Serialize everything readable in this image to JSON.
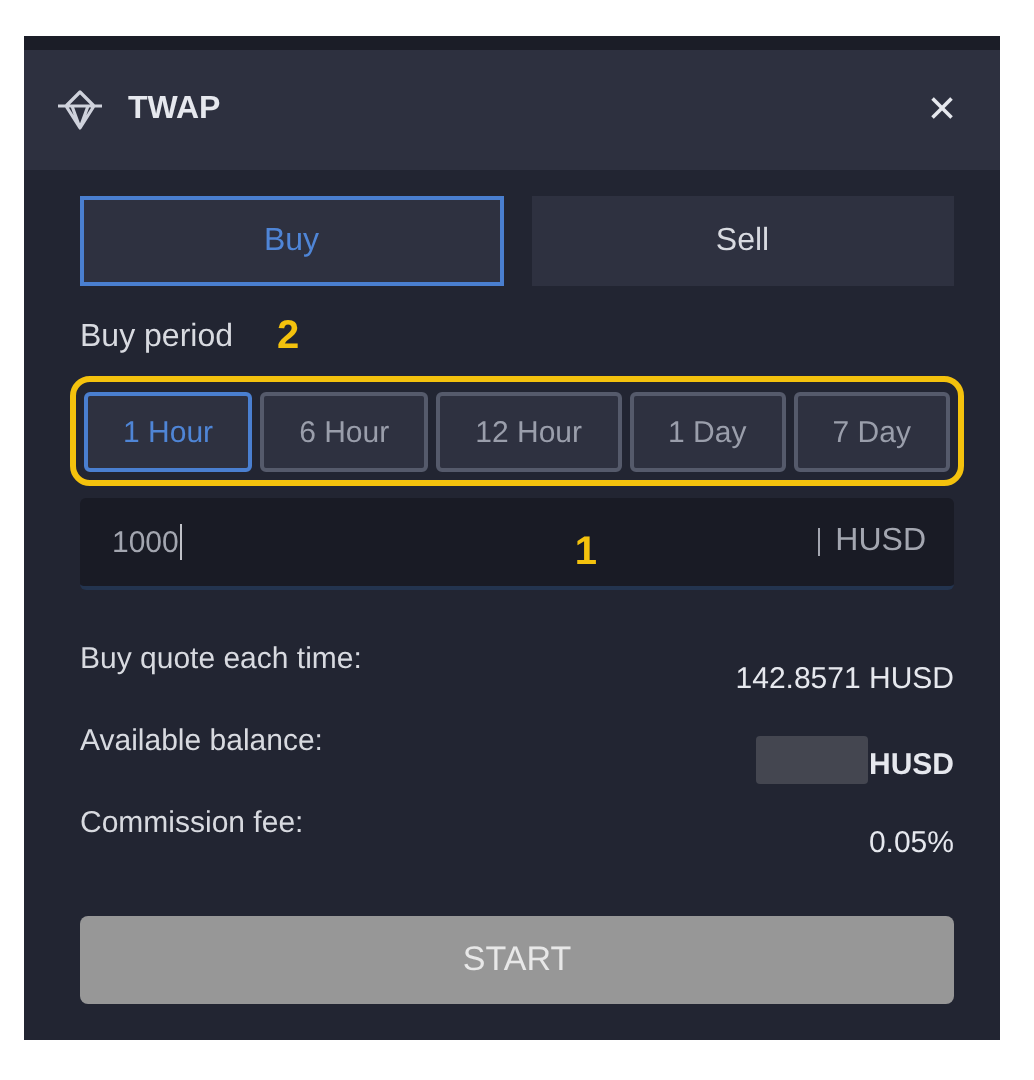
{
  "window": {
    "title": "TWAP",
    "close": "×"
  },
  "sides": [
    {
      "label": "Buy",
      "selected": true
    },
    {
      "label": "Sell",
      "selected": false
    }
  ],
  "period": {
    "label": "Buy period",
    "options": [
      {
        "label": "1 Hour",
        "selected": true
      },
      {
        "label": "6 Hour",
        "selected": false
      },
      {
        "label": "12 Hour",
        "selected": false
      },
      {
        "label": "1 Day",
        "selected": false
      },
      {
        "label": "7 Day",
        "selected": false
      }
    ]
  },
  "amount": {
    "value": "1000",
    "unit": "HUSD"
  },
  "details": [
    {
      "label": "Buy quote each time:",
      "value": "142.8571 HUSD",
      "hidden": false
    },
    {
      "label": "Available balance:",
      "value": "HUSD",
      "hidden": true
    },
    {
      "label": "Commission fee:",
      "value": "0.05%",
      "hidden": false
    }
  ],
  "start_button": {
    "label": "START",
    "disabled": true
  },
  "annotations": [
    {
      "number": "2"
    },
    {
      "number": "1"
    }
  ]
}
